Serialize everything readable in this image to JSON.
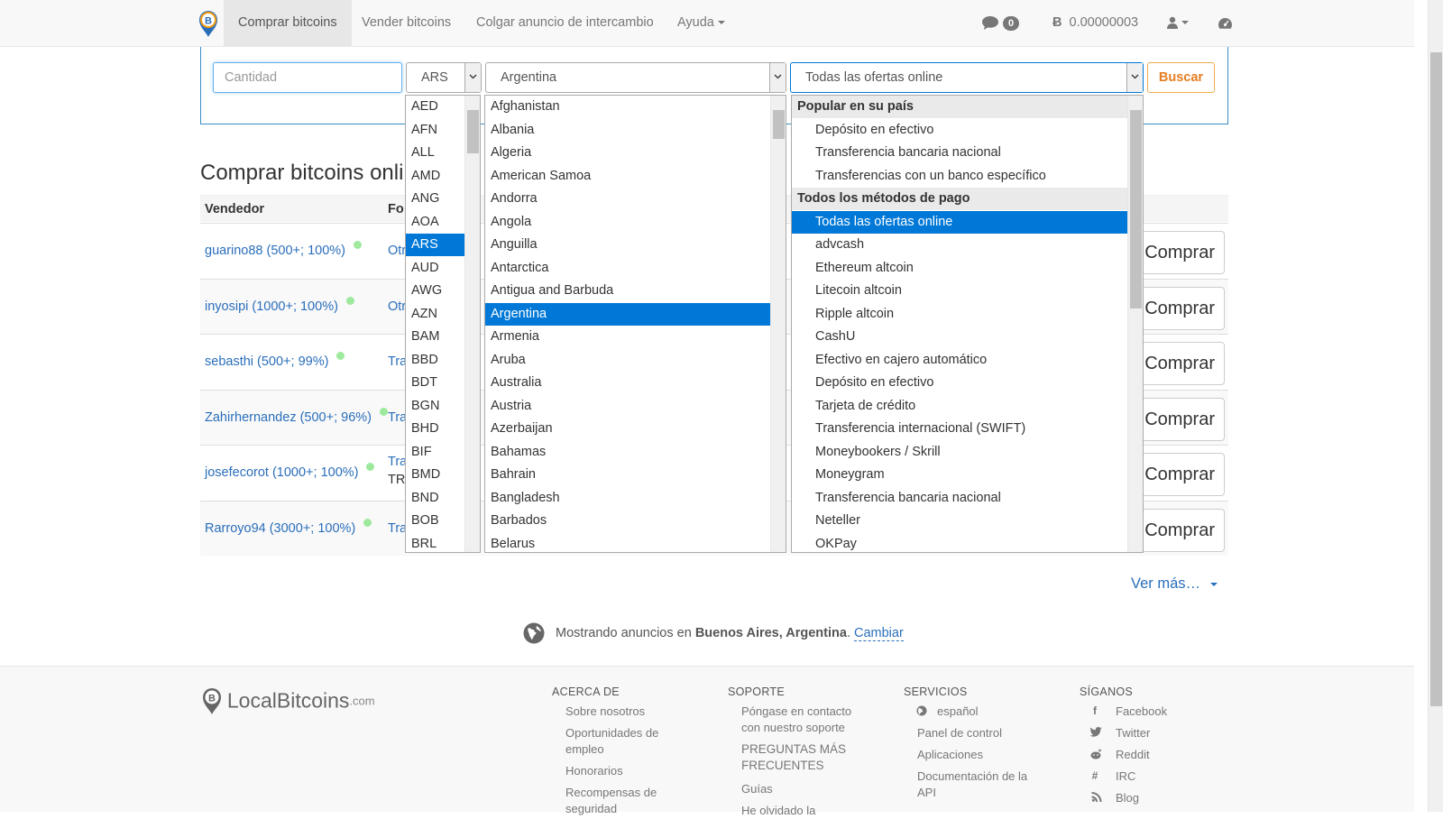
{
  "nav": {
    "buy": "Comprar bitcoins",
    "sell": "Vender bitcoins",
    "post_ad": "Colgar anuncio de intercambio",
    "help": "Ayuda",
    "messages_count": "0",
    "btc_balance": "0.00000003"
  },
  "search": {
    "amount_placeholder": "Cantidad",
    "currency": "ARS",
    "country": "Argentina",
    "offer_type": "Todas las ofertas online",
    "button": "Buscar"
  },
  "page_title": "Comprar bitcoins onli",
  "table": {
    "col_seller": "Vendedor",
    "col_payment": "Fo",
    "buy_label": "Comprar",
    "rows": [
      {
        "seller": "guarino88 (500+; 100%)",
        "payment": "Otr"
      },
      {
        "seller": "inyosipi (1000+; 100%)",
        "payment": "Otr"
      },
      {
        "seller": "sebasthi (500+; 99%)",
        "payment": "Tra"
      },
      {
        "seller": "Zahirhernandez (500+; 96%)",
        "payment": "Tra"
      },
      {
        "seller": "josefecorot (1000+; 100%)",
        "payment": "Tra",
        "payment2": "TR"
      },
      {
        "seller": "Rarroyo94 (3000+; 100%)",
        "payment": "Tra"
      }
    ]
  },
  "currency_list": [
    "AED",
    "AFN",
    "ALL",
    "AMD",
    "ANG",
    "AOA",
    "ARS",
    "AUD",
    "AWG",
    "AZN",
    "BAM",
    "BBD",
    "BDT",
    "BGN",
    "BHD",
    "BIF",
    "BMD",
    "BND",
    "BOB",
    "BRL"
  ],
  "currency_selected": "ARS",
  "country_list": [
    "Afghanistan",
    "Albania",
    "Algeria",
    "American Samoa",
    "Andorra",
    "Angola",
    "Anguilla",
    "Antarctica",
    "Antigua and Barbuda",
    "Argentina",
    "Armenia",
    "Aruba",
    "Australia",
    "Austria",
    "Azerbaijan",
    "Bahamas",
    "Bahrain",
    "Bangladesh",
    "Barbados",
    "Belarus"
  ],
  "country_selected": "Argentina",
  "offer_groups": [
    {
      "label": "Popular en su país",
      "items": [
        "Depósito en efectivo",
        "Transferencia bancaria nacional",
        "Transferencias con un banco específico"
      ]
    },
    {
      "label": "Todos los métodos de pago",
      "items": [
        "Todas las ofertas online",
        "advcash",
        "Ethereum altcoin",
        "Litecoin altcoin",
        "Ripple altcoin",
        "CashU",
        "Efectivo en cajero automático",
        "Depósito en efectivo",
        "Tarjeta de crédito",
        "Transferencia internacional (SWIFT)",
        "Moneybookers / Skrill",
        "Moneygram",
        "Transferencia bancaria nacional",
        "Neteller",
        "OKPay"
      ]
    }
  ],
  "offer_selected": "Todas las ofertas online",
  "see_more": "Ver más…",
  "location": {
    "prefix": "Mostrando anuncios en",
    "place": "Buenos Aires, Argentina",
    "dot": ".",
    "change": "Cambiar"
  },
  "footer": {
    "brand": "LocalBitcoins",
    "brand_suffix": ".com",
    "about": {
      "title": "ACERCA DE",
      "links": [
        "Sobre nosotros",
        "Oportunidades de empleo",
        "Honorarios",
        "Recompensas de seguridad"
      ]
    },
    "support": {
      "title": "SOPORTE",
      "links": [
        "Póngase en contacto con nuestro soporte",
        "PREGUNTAS MÁS FRECUENTES",
        "Guías",
        "He olvidado la"
      ]
    },
    "services": {
      "title": "SERVICIOS",
      "links": [
        "español",
        "Panel de control",
        "Aplicaciones",
        "Documentación de la API"
      ]
    },
    "follow": {
      "title": "SÍGANOS",
      "links": [
        "Facebook",
        "Twitter",
        "Reddit",
        "IRC",
        "Blog"
      ]
    }
  },
  "colors": {
    "link": "#2a6ebb",
    "selected": "#0078d7",
    "accent": "#e67e22",
    "border": "#3c8dc5"
  }
}
